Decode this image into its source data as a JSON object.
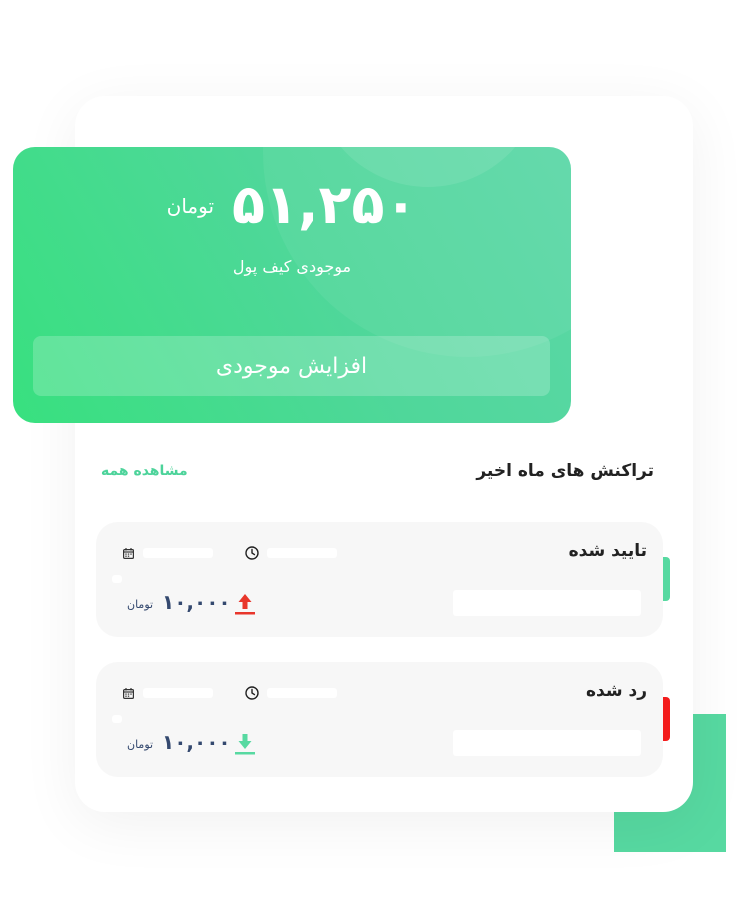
{
  "wallet": {
    "balance": "۵۱,۲۵۰",
    "currency": "تومان",
    "label": "موجودی کیف پول",
    "topup_label": "افزایش موجودی"
  },
  "transactions_section": {
    "title": "تراکنش های ماه اخیر",
    "view_all_label": "مشاهده همه"
  },
  "transactions": [
    {
      "status": "تایید شده",
      "amount": "۱۰,۰۰۰",
      "currency": "تومان",
      "direction": "outgoing",
      "arrow_icon": "arrow-up-icon",
      "accent_color": "#57d9a1",
      "arrow_color": "#e8362b"
    },
    {
      "status": "رد شده",
      "amount": "۱۰,۰۰۰",
      "currency": "تومان",
      "direction": "incoming",
      "arrow_icon": "arrow-down-icon",
      "accent_color": "#f31c1c",
      "arrow_color": "#57d9a1"
    }
  ],
  "colors": {
    "brand_green": "#57d9a1",
    "amount_text": "#34496f",
    "reject_red": "#f31c1c",
    "outgoing_arrow": "#e8362b"
  }
}
